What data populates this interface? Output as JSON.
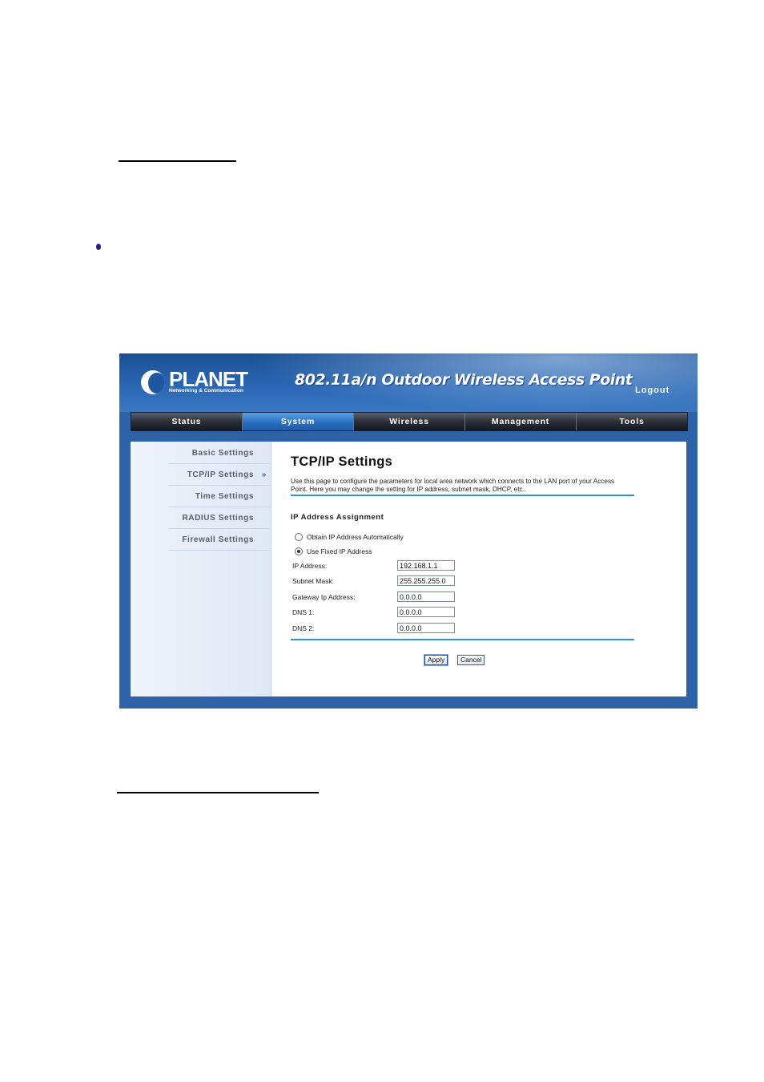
{
  "banner": {
    "logo_text": "PLANET",
    "logo_subtitle": "Networking & Communication",
    "product_title": "802.11a/n Outdoor Wireless Access Point",
    "logout_label": "Logout"
  },
  "nav": {
    "tabs": [
      {
        "label": "Status"
      },
      {
        "label": "System"
      },
      {
        "label": "Wireless"
      },
      {
        "label": "Management"
      },
      {
        "label": "Tools"
      }
    ],
    "active_tab": "System"
  },
  "sidebar": {
    "items": [
      {
        "label": "Basic Settings"
      },
      {
        "label": "TCP/IP Settings"
      },
      {
        "label": "Time Settings"
      },
      {
        "label": "RADIUS Settings"
      },
      {
        "label": "Firewall Settings"
      }
    ],
    "active_item_marker": "»"
  },
  "content": {
    "title": "TCP/IP Settings",
    "description": "Use this page to configure the parameters for local area network which connects to the LAN port of your Access Point. Here you may change the setting for IP address, subnet mask, DHCP, etc..",
    "section_title": "IP Address Assignment",
    "radio_auto_label": "Obtain IP Address Automatically",
    "radio_fixed_label": "Use Fixed IP Address",
    "selected_mode": "Use Fixed IP Address",
    "fields": [
      {
        "label": "IP Address:",
        "value": "192.168.1.1"
      },
      {
        "label": "Subnet Mask:",
        "value": "255.255.255.0"
      },
      {
        "label": "Gateway Ip Address:",
        "value": "0.0.0.0"
      },
      {
        "label": "DNS 1:",
        "value": "0.0.0.0"
      },
      {
        "label": "DNS 2:",
        "value": "0.0.0.0"
      }
    ],
    "apply_label": "Apply",
    "cancel_label": "Cancel"
  },
  "colors": {
    "frame_blue": "#2f63a8",
    "active_tab": "#2a6fc1",
    "rule_teal": "#2a9bc1"
  }
}
